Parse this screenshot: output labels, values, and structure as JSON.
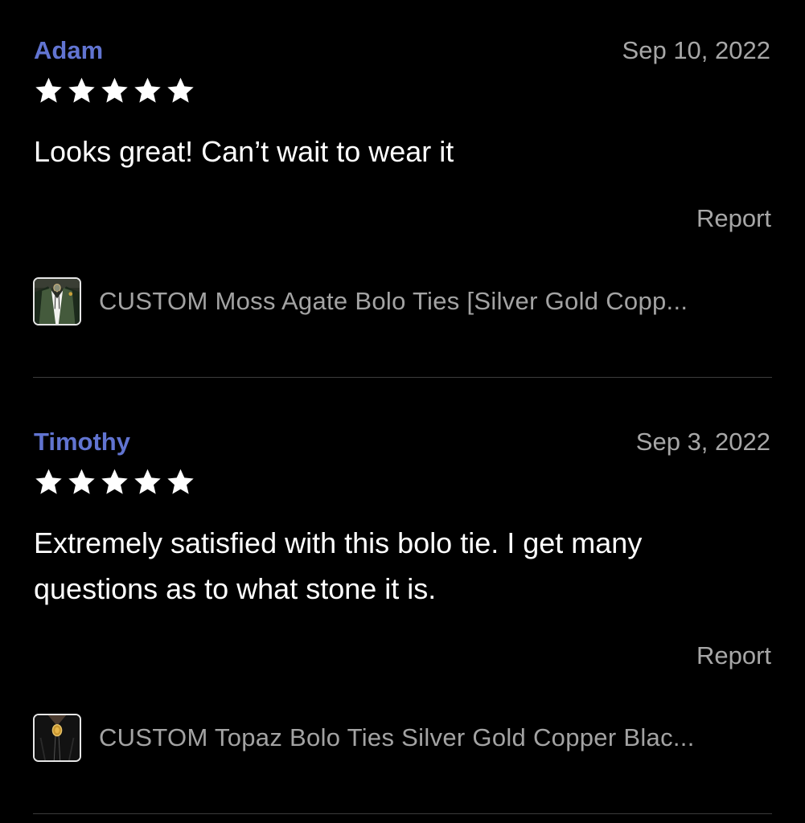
{
  "colors": {
    "background": "#000000",
    "reviewer_name": "#6174d1",
    "muted_text": "#a7a7a7",
    "star": "#ffffff",
    "divider": "#3c3c3c"
  },
  "reviews": [
    {
      "reviewer": "Adam",
      "date": "Sep 10, 2022",
      "rating": 5,
      "text": "Looks great! Can’t wait to wear it",
      "report_label": "Report",
      "product": {
        "thumbnail_icon": "bolo-tie-moss-agate-thumbnail",
        "title": "CUSTOM Moss Agate Bolo Ties [Silver Gold Copp..."
      }
    },
    {
      "reviewer": "Timothy",
      "date": "Sep 3, 2022",
      "rating": 5,
      "text": "Extremely satisfied with this bolo tie.  I get many questions as to what stone it is.",
      "report_label": "Report",
      "product": {
        "thumbnail_icon": "bolo-tie-topaz-thumbnail",
        "title": "CUSTOM Topaz Bolo Ties Silver Gold Copper Blac..."
      }
    }
  ]
}
